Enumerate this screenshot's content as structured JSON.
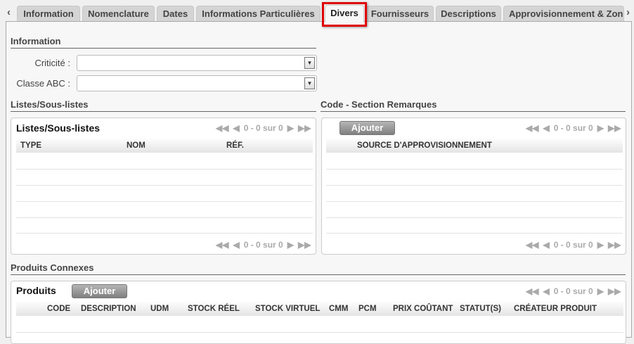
{
  "tabs": [
    "Information",
    "Nomenclature",
    "Dates",
    "Informations Particulières",
    "Divers",
    "Fournisseurs",
    "Descriptions",
    "Approvisionnement & Zon"
  ],
  "active_tab": "Divers",
  "nav": {
    "prev": "‹",
    "next": "›"
  },
  "information": {
    "title": "Information",
    "criticite_label": "Criticité :",
    "criticite_value": "",
    "classe_label": "Classe ABC :",
    "classe_value": ""
  },
  "listes": {
    "section_title": "Listes/Sous-listes",
    "grid_title": "Listes/Sous-listes",
    "pager": "0 - 0 sur 0",
    "columns": [
      "TYPE",
      "NOM",
      "RÉF."
    ]
  },
  "code": {
    "section_title": "Code - Section Remarques",
    "add_label": "Ajouter",
    "pager": "0 - 0 sur 0",
    "columns": [
      "SOURCE D'APPROVISIONNEMENT"
    ]
  },
  "produits": {
    "section_title": "Produits Connexes",
    "grid_title": "Produits",
    "add_label": "Ajouter",
    "pager": "0 - 0 sur 0",
    "columns": [
      "CODE",
      "DESCRIPTION",
      "UDM",
      "STOCK RÉEL",
      "STOCK VIRTUEL",
      "CMM",
      "PCM",
      "PRIX COÛTANT",
      "STATUT(S)",
      "CRÉATEUR PRODUIT"
    ]
  },
  "pager_icons": {
    "first": "◀◀",
    "prev": "◀",
    "next": "▶",
    "last": "▶▶"
  }
}
